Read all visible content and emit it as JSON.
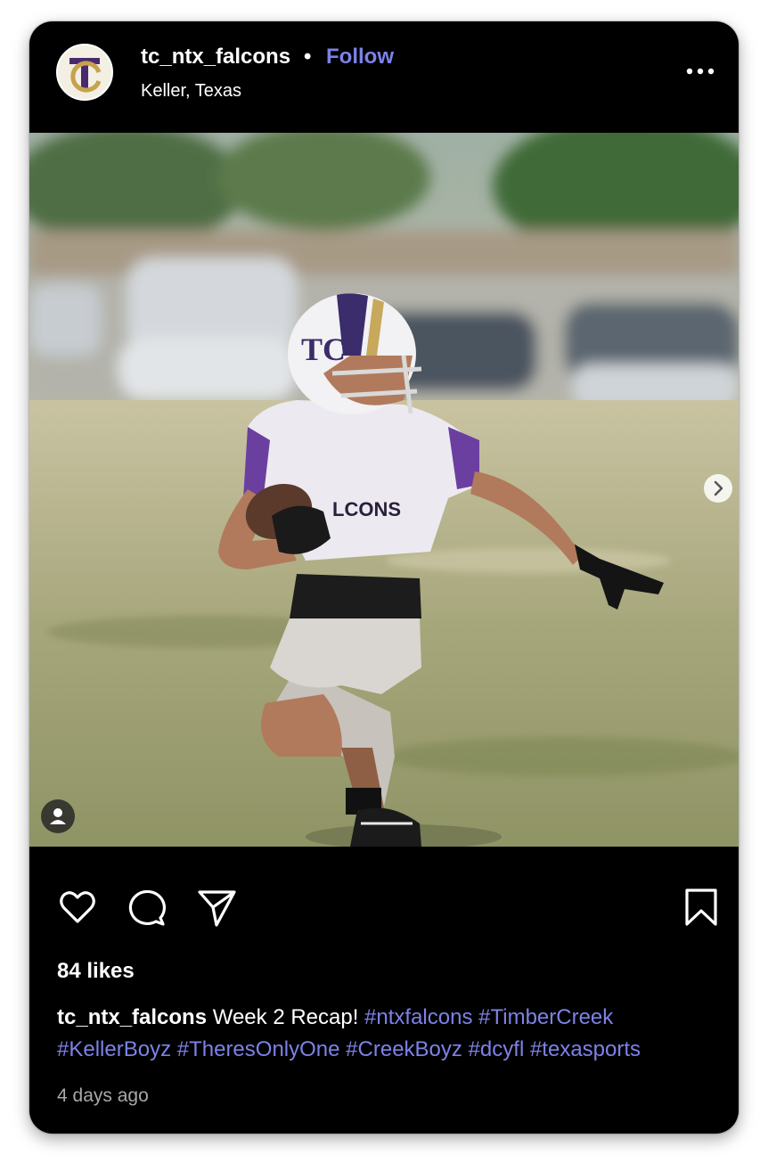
{
  "post": {
    "username": "tc_ntx_falcons",
    "separator": "•",
    "follow_label": "Follow",
    "location": "Keller, Texas",
    "avatar_text": "TC",
    "more_icon": "more-horizontal-icon",
    "likes": "84 likes",
    "caption_user": "tc_ntx_falcons",
    "caption_text": "Week 2 Recap!",
    "hashtags": [
      "#ntxfalcons",
      "#TimberCreek",
      "#KellerBoyz",
      "#TheresOnlyOne",
      "#CreekBoyz",
      "#dcyfl",
      "#texasports"
    ],
    "time_ago": "4 days ago",
    "photo_helmet_text": "TC",
    "photo_jersey_text": "LCONS"
  },
  "icons": {
    "like": "heart-icon",
    "comment": "comment-icon",
    "share": "send-icon",
    "save": "bookmark-icon",
    "next": "chevron-right-icon",
    "tagged": "user-icon"
  },
  "colors": {
    "background": "#000000",
    "accent": "#7d82e6",
    "text": "#ffffff",
    "muted": "#a8a8a8"
  }
}
